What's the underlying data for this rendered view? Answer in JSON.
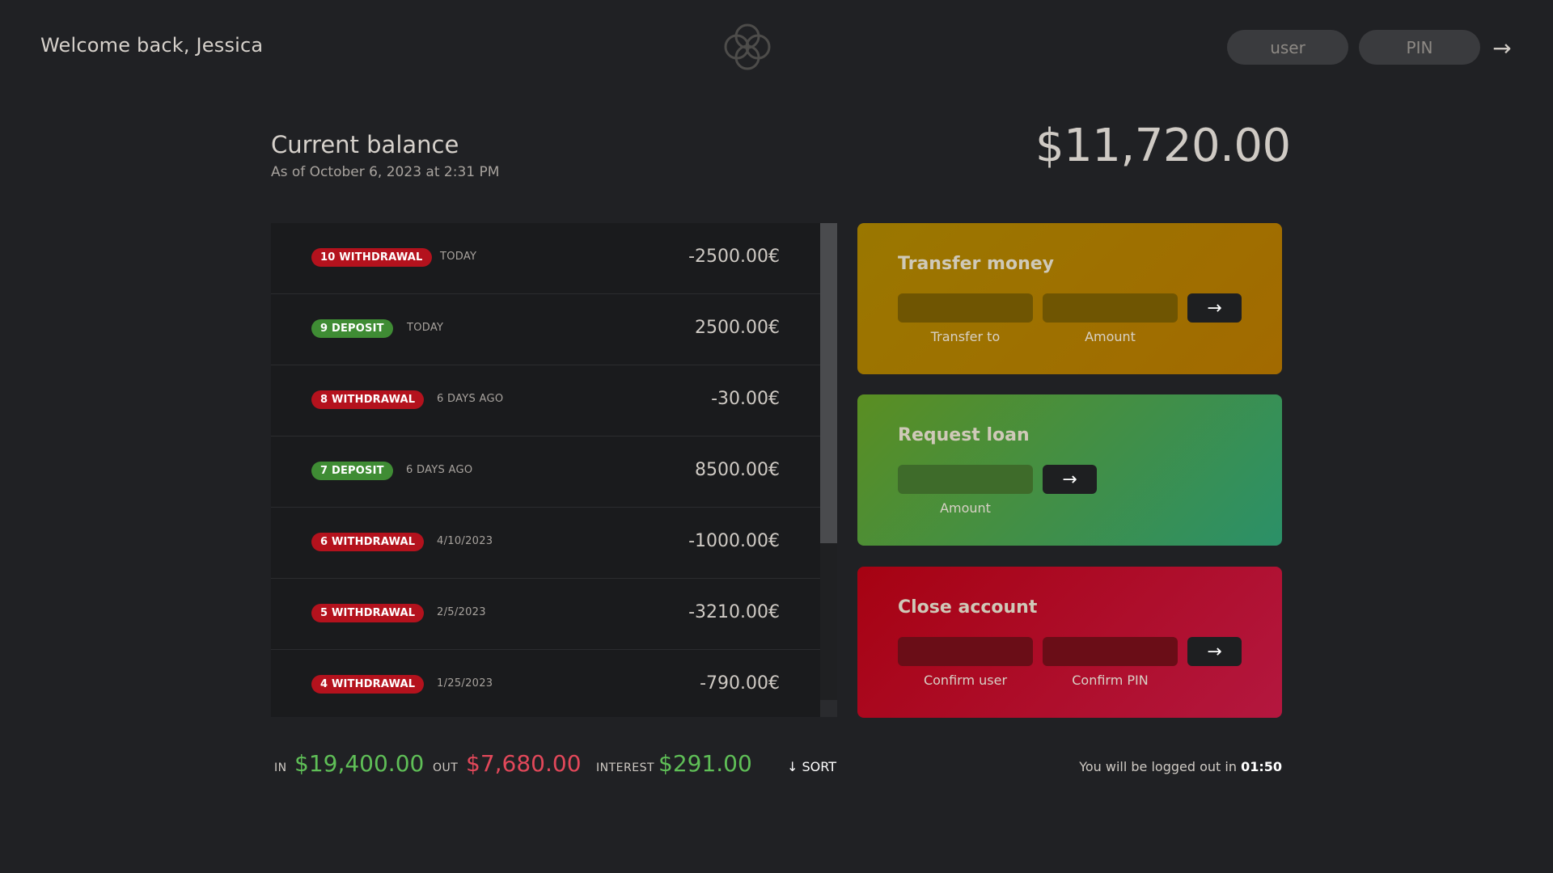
{
  "nav": {
    "welcome": "Welcome back, Jessica",
    "user_placeholder": "user",
    "pin_placeholder": "PIN",
    "login_arrow": "→"
  },
  "balance": {
    "title": "Current balance",
    "date": "As of October 6, 2023 at 2:31 PM",
    "value": "$11,720.00"
  },
  "movements": [
    {
      "type": "withdrawal",
      "label": "10 WITHDRAWAL",
      "date": "TODAY",
      "value": "-2500.00€"
    },
    {
      "type": "deposit",
      "label": "9 DEPOSIT",
      "date": "TODAY",
      "value": "2500.00€"
    },
    {
      "type": "withdrawal",
      "label": "8 WITHDRAWAL",
      "date": "6 DAYS AGO",
      "value": "-30.00€"
    },
    {
      "type": "deposit",
      "label": "7 DEPOSIT",
      "date": "6 DAYS AGO",
      "value": "8500.00€"
    },
    {
      "type": "withdrawal",
      "label": "6 WITHDRAWAL",
      "date": "4/10/2023",
      "value": "-1000.00€"
    },
    {
      "type": "withdrawal",
      "label": "5 WITHDRAWAL",
      "date": "2/5/2023",
      "value": "-3210.00€"
    },
    {
      "type": "withdrawal",
      "label": "4 WITHDRAWAL",
      "date": "1/25/2023",
      "value": "-790.00€"
    }
  ],
  "operations": {
    "transfer": {
      "title": "Transfer money",
      "label_to": "Transfer to",
      "label_amount": "Amount",
      "button": "→"
    },
    "loan": {
      "title": "Request loan",
      "label_amount": "Amount",
      "button": "→"
    },
    "close": {
      "title": "Close account",
      "label_user": "Confirm user",
      "label_pin": "Confirm PIN",
      "button": "→"
    }
  },
  "summary": {
    "in_label": "IN",
    "in_value": "$19,400.00",
    "out_label": "OUT",
    "out_value": "$7,680.00",
    "interest_label": "INTEREST",
    "interest_value": "$291.00",
    "sort": "↓ SORT",
    "timer_text": "You will be logged out in",
    "timer_value": "01:50"
  },
  "colors": {
    "background": "#202124",
    "withdrawal": "#b4121d",
    "deposit": "#3f8c34",
    "in": "#5fbf57",
    "out": "#e2485a"
  }
}
